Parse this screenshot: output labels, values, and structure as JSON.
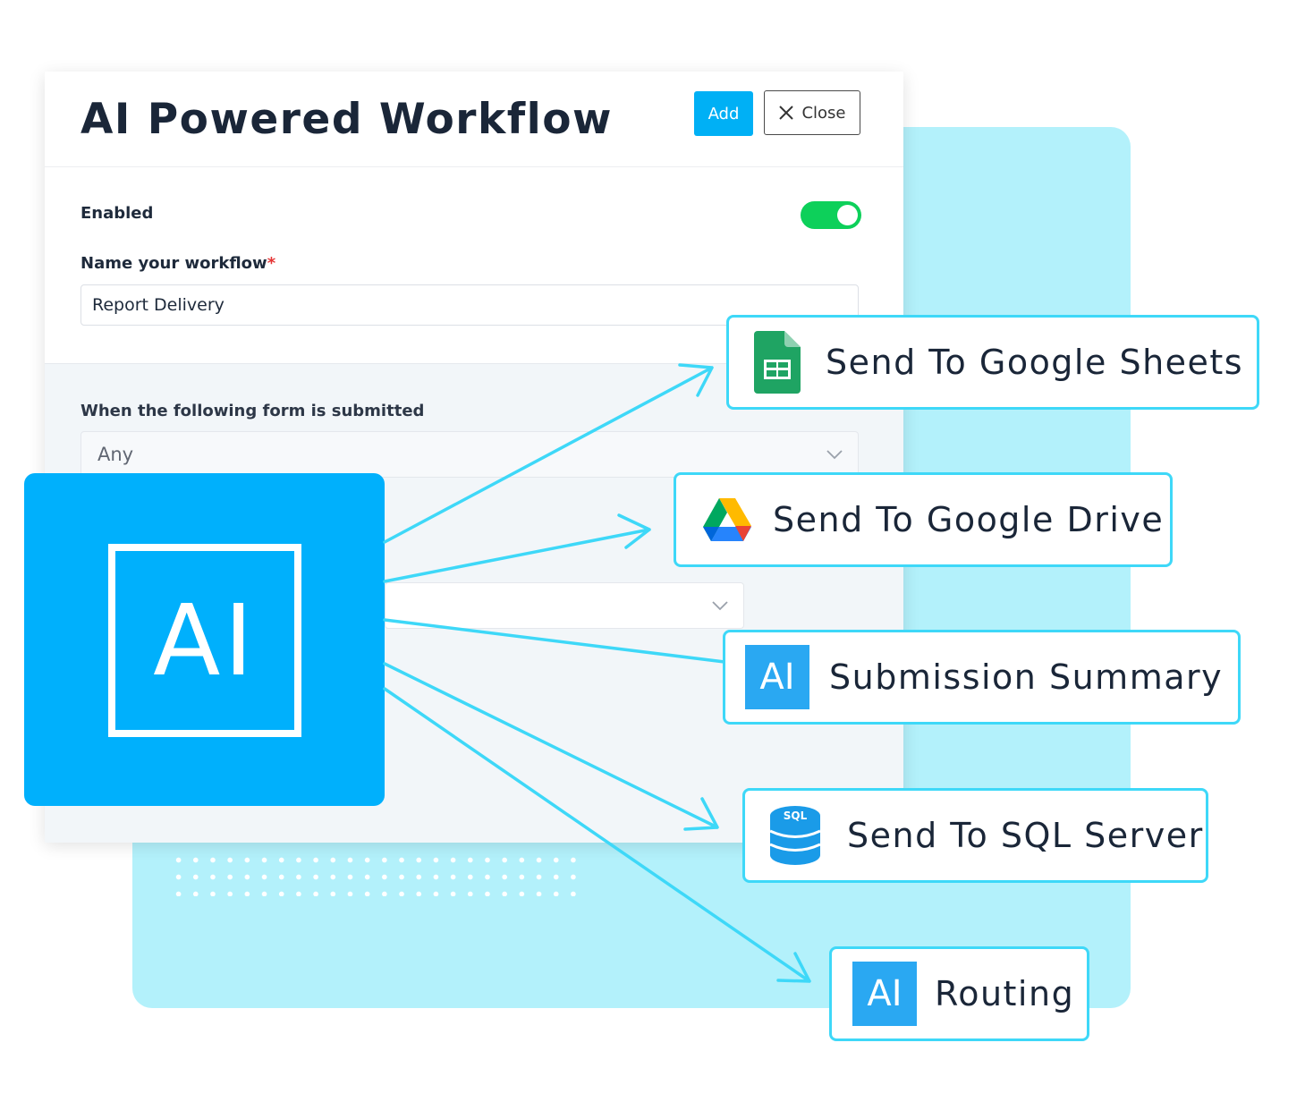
{
  "dialog": {
    "title": "AI Powered Workflow",
    "add_label": "Add",
    "close_label": "Close",
    "enabled_label": "Enabled",
    "enabled": true,
    "name_label": "Name your workflow",
    "required_mark": "*",
    "name_value": "Report Delivery",
    "trigger_label": "When the following form is submitted",
    "form_selected": "Any"
  },
  "ai_block": {
    "label": "AI"
  },
  "actions": [
    {
      "label": "Send To Google Sheets",
      "icon": "google-sheets-icon"
    },
    {
      "label": "Send To Google Drive",
      "icon": "google-drive-icon"
    },
    {
      "label": "Submission Summary",
      "icon": "ai-icon",
      "icon_text": "AI"
    },
    {
      "label": "Send To SQL Server",
      "icon": "sql-database-icon",
      "icon_text": "SQL"
    },
    {
      "label": "Routing",
      "icon": "ai-icon",
      "icon_text": "AI"
    }
  ],
  "colors": {
    "accent": "#00b0f5",
    "toggle_on": "#0dd05a",
    "arrow": "#3ed8f8",
    "panel_bg": "#b3f1fb"
  }
}
